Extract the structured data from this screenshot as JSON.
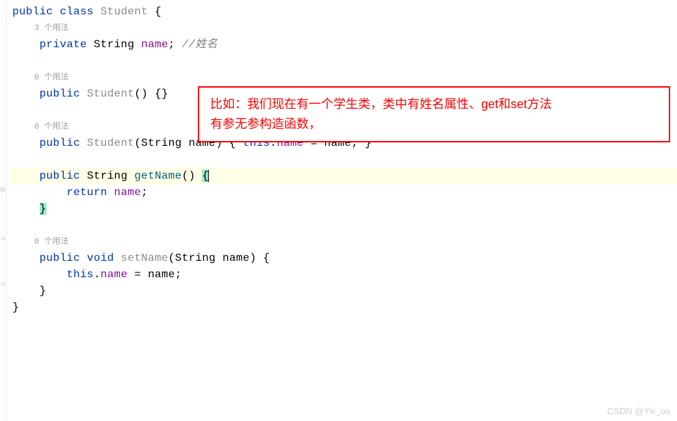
{
  "code": {
    "line1": {
      "public": "public",
      "class": "class",
      "classname": "Student",
      "brace": " {"
    },
    "usage1": "3 个用法",
    "line2": {
      "private": "private",
      "type": "String",
      "name": "name",
      "semi": ";",
      "comment": "//姓名"
    },
    "usage2": "0 个用法",
    "line3": {
      "public": "public",
      "ctor": "Student",
      "parens": "() {}"
    },
    "usage3": "0 个用法",
    "line4": {
      "public": "public",
      "ctor": "Student",
      "paren_open": "(",
      "ptype": "String",
      "pname": " name) ",
      "brace_open": "{",
      "this": " this",
      "dot": ".",
      "field": "name",
      "eq": " = ",
      "param": "name",
      "semi": "; ",
      "brace_close": "}"
    },
    "line5": {
      "public": "public",
      "rtype": "String",
      "method": "getName",
      "parens": "() ",
      "brace": "{"
    },
    "line6": {
      "return": "return",
      "name": "name",
      "semi": ";"
    },
    "line7": {
      "brace": "}"
    },
    "usage4": "0 个用法",
    "line8": {
      "public": "public",
      "void": "void",
      "method": "setName",
      "paren_open": "(",
      "ptype": "String",
      "pname": " name) {",
      "close": ""
    },
    "line9": {
      "this": "this",
      "dot": ".",
      "field": "name",
      "eq": " = ",
      "param": "name",
      "semi": ";"
    },
    "line10": {
      "brace": "}"
    },
    "line11": {
      "brace": "}"
    }
  },
  "annotation": {
    "line1": "比如：我们现在有一个学生类，类中有姓名属性、get和set方法",
    "line2": "有参无参构造函数，"
  },
  "watermark": "CSDN @Yiii_oo"
}
